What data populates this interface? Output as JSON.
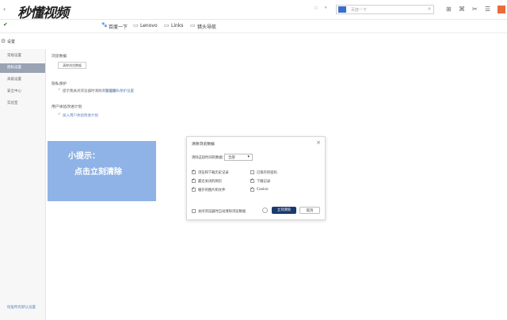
{
  "watermark": "秒懂视频",
  "browser": {
    "search_placeholder": "百度一下",
    "bookmarks": [
      "百度一下",
      "Lenovo",
      "Links",
      "猎头导航"
    ]
  },
  "settings": {
    "title": "设置",
    "nav": [
      "常规设置",
      "隐私设置",
      "高级设置",
      "安全中心",
      "实验室"
    ],
    "active_nav": "隐私设置",
    "bottom_link": "恢复所有默认设置",
    "sections": {
      "browse_data": {
        "heading": "浏览数据",
        "button": "清除浏览数据"
      },
      "privacy": {
        "heading": "隐私保护",
        "option": "提示我关闭浏览器时清除浏览记录",
        "link": "管理隐私保护设置"
      },
      "plan": {
        "heading": "用户体验改进计划",
        "option": "加入用户体验改进计划"
      }
    }
  },
  "tip": {
    "line1": "小提示：",
    "line2": "点击立刻清除"
  },
  "dialog": {
    "title": "清除浏览数据",
    "range_label": "清除这段时间的数据：",
    "range_value": "全部",
    "options": [
      {
        "label": "浏览和下载历史记录",
        "checked": true
      },
      {
        "label": "已保存的密码",
        "checked": false
      },
      {
        "label": "最近关闭的网页",
        "checked": true
      },
      {
        "label": "下载记录",
        "checked": true
      },
      {
        "label": "缓存的图片和文件",
        "checked": true
      },
      {
        "label": "Cookie",
        "checked": true
      }
    ],
    "close_clear": "关闭浏览器时自动清除浏览数据",
    "clear_button": "立刻清除",
    "cancel_button": "取消"
  },
  "colors": {
    "tip_bg": "#8fb3e7",
    "accent": "#1a3a6e",
    "sidebar_active": "#9aa3b3"
  }
}
